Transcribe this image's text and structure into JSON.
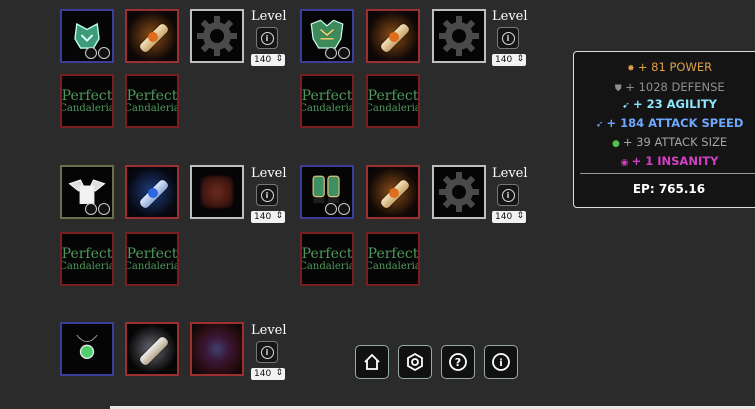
{
  "level_label": "Level",
  "level_value": "140",
  "perfect_card": {
    "line1": "Perfect",
    "line2": "Candaleria"
  },
  "slots": {
    "helmet": "helmet-icon",
    "chest": "chest-armor-icon",
    "shoulders": "shoulder-armor-icon",
    "gloves": "gloves-icon",
    "amulet": "amulet-icon",
    "enchant_scroll": "scroll-icon",
    "empty_gear": "gear-icon",
    "rune": "rune-icon"
  },
  "stats": {
    "power": {
      "text": "+ 81 POWER",
      "color": "#e0a04a"
    },
    "defense": {
      "text": "+ 1028 DEFENSE",
      "color": "#8f8f8f"
    },
    "agility": {
      "text": "+ 23 AGILITY",
      "color": "#8fe6ff"
    },
    "attack_speed": {
      "text": "+ 184 ATTACK SPEED",
      "color": "#6fa8ff"
    },
    "attack_size": {
      "text": "+ 39 ATTACK SIZE",
      "color": "#a5a5a5"
    },
    "insanity": {
      "text": "+ 1 INSANITY",
      "color": "#d33fc5"
    },
    "ep": "EP: 765.16"
  },
  "nav": {
    "home": "home-icon",
    "settings": "hexagon-settings-icon",
    "help": "help-icon",
    "info": "info-icon"
  },
  "colors": {
    "background": "#2b2b2c",
    "perfect_text": "#4f9a5d",
    "rare_border": "#3b3f9a",
    "legendary_border": "#9c2f2f"
  }
}
